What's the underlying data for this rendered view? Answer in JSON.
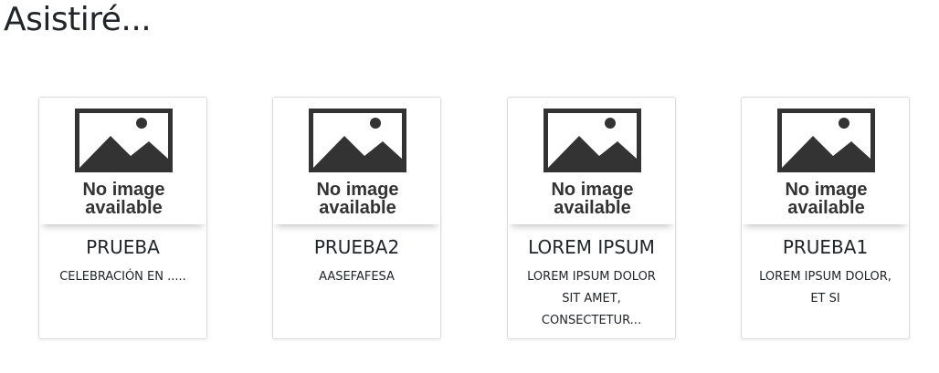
{
  "page": {
    "title": "Asistiré..."
  },
  "placeholder": {
    "line1": "No image",
    "line2": "available"
  },
  "cards": [
    {
      "title": "PRUEBA",
      "description": "CELEBRACIÓN EN ....."
    },
    {
      "title": "PRUEBA2",
      "description": "AASEFAFESA"
    },
    {
      "title": "LOREM IPSUM",
      "description": "LOREM IPSUM DOLOR SIT AMET, CONSECTETUR..."
    },
    {
      "title": "PRUEBA1",
      "description": "LOREM IPSUM DOLOR, ET SI"
    }
  ]
}
